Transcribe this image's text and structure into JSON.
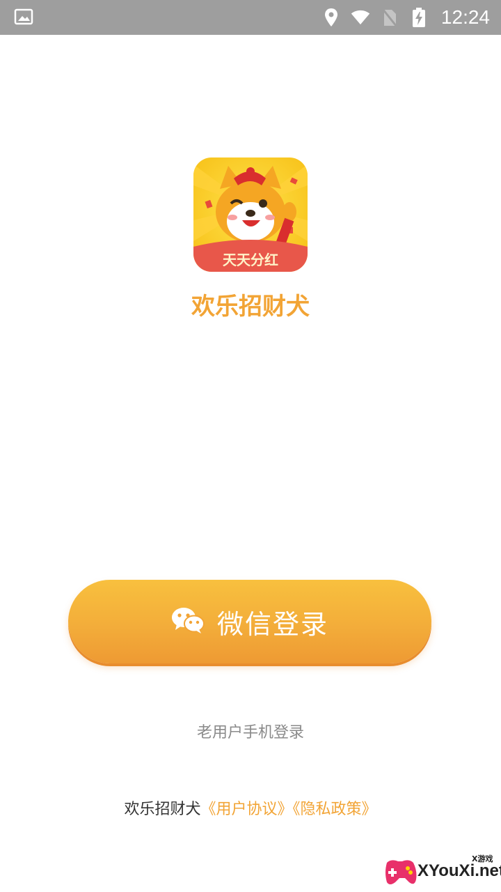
{
  "status_bar": {
    "time": "12:24",
    "icons": [
      "image-icon",
      "location-icon",
      "wifi-icon",
      "no-sim-icon",
      "battery-charging-icon"
    ],
    "background": "#9e9e9e"
  },
  "app": {
    "name": "欢乐招财犬",
    "logo_icon": "shiba-dog-logo-icon",
    "logo_banner_text": "天天分红",
    "accent_color": "#f2a435"
  },
  "login": {
    "wechat_label": "微信登录",
    "wechat_icon": "wechat-icon",
    "phone_login_label": "老用户手机登录"
  },
  "agreement": {
    "prefix": "欢乐招财犬",
    "user_agreement": "《用户协议》",
    "privacy_policy": "《隐私政策》"
  },
  "watermark": {
    "text": "XYouXi.net",
    "small_text": "X游戏"
  }
}
